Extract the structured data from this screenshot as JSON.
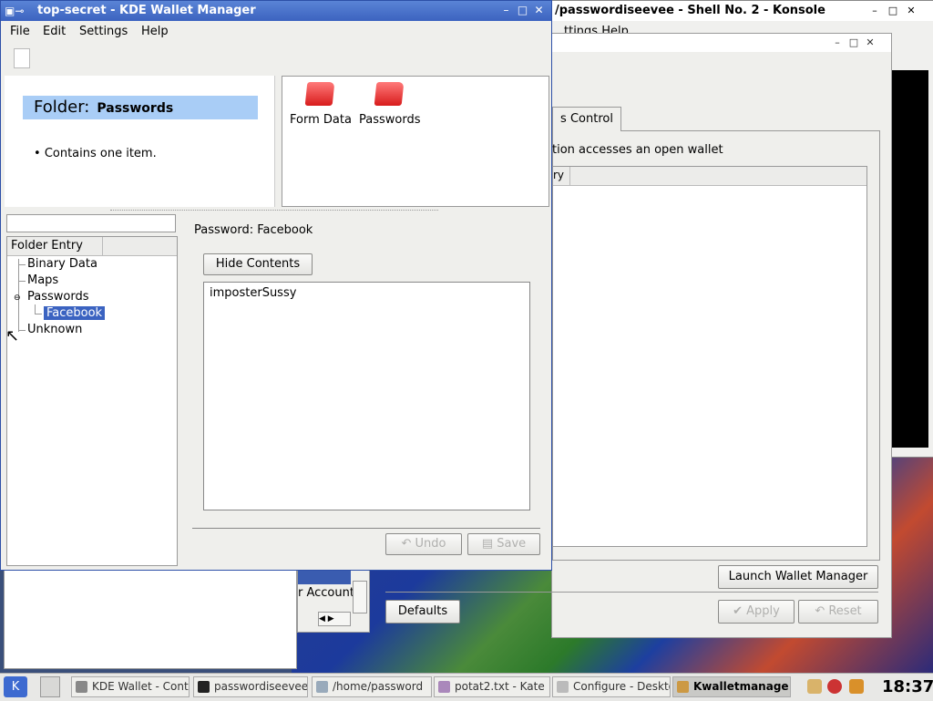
{
  "kwallet": {
    "title": "top-secret - KDE Wallet Manager",
    "menu": [
      "File",
      "Edit",
      "Settings",
      "Help"
    ],
    "folder_heading_prefix": "Folder:",
    "folder_heading_name": "Passwords",
    "contains_text": "Contains one item.",
    "icons": [
      {
        "label": "Form Data",
        "icon": "folder-icon"
      },
      {
        "label": "Passwords",
        "icon": "folder-icon"
      }
    ],
    "tree_header": "Folder Entry",
    "tree": [
      "Binary Data",
      "Maps",
      "Passwords",
      "Facebook",
      "Unknown"
    ],
    "detail_title": "Password: Facebook",
    "hide_contents": "Hide Contents",
    "content_value": "imposterSussy",
    "undo": "Undo",
    "save": "Save"
  },
  "konsole": {
    "title": "/passwordiseevee - Shell No. 2 - Konsole",
    "menu_partial": "ttings   Help"
  },
  "config": {
    "tab_partial": "s Control",
    "note_partial": "tion accesses an open wallet",
    "list_header_partial": "ry",
    "launch": "Launch Wallet Manager",
    "defaults": "Defaults",
    "apply": "Apply",
    "reset": "Reset"
  },
  "background": {
    "account_partial": "r Account"
  },
  "taskbar": {
    "tasks": [
      "KDE Wallet - Contro",
      "passwordiseevee",
      "/home/password",
      "potat2.txt - Kate",
      "Configure - Deskto",
      "Kwalletmanage"
    ],
    "clock": "18:37"
  }
}
